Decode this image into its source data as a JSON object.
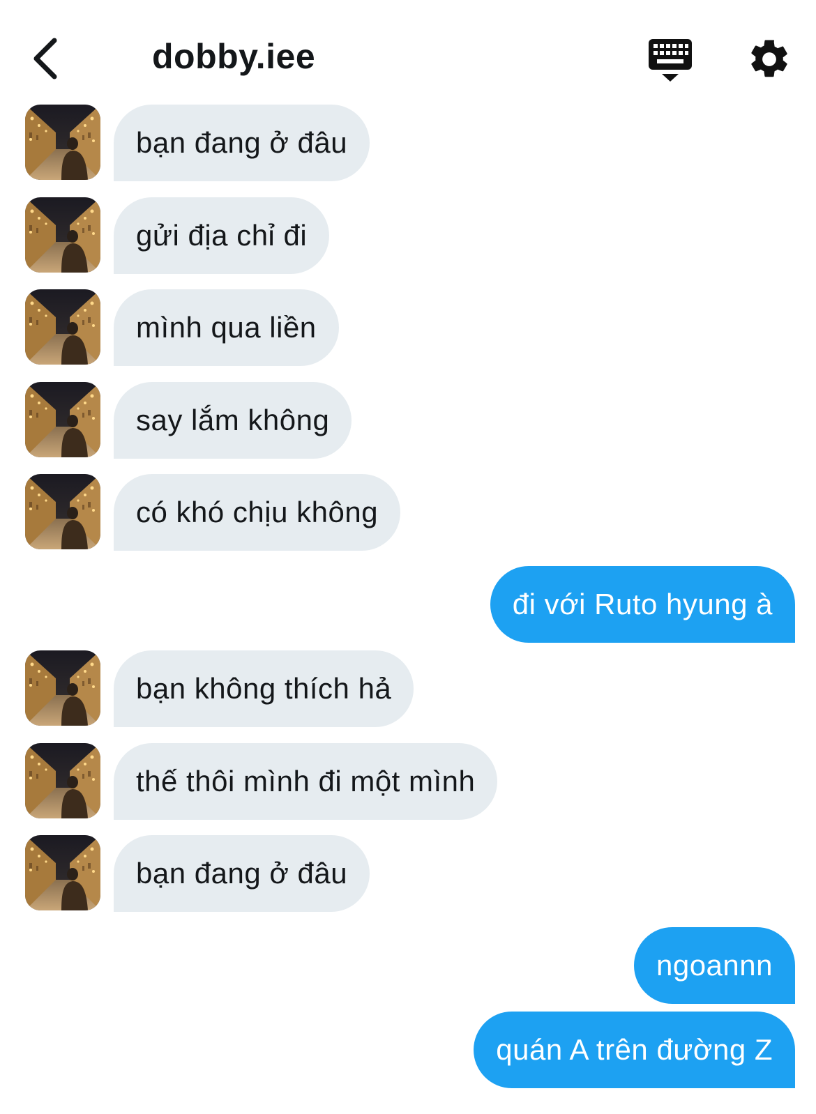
{
  "header": {
    "title": "dobby.iee",
    "icons": {
      "back": "chevron-left-icon",
      "keyboard": "keyboard-icon",
      "settings": "gear-icon"
    }
  },
  "colors": {
    "incoming_bubble": "#e6ecf0",
    "outgoing_bubble": "#1da1f2",
    "text": "#14171a"
  },
  "messages": [
    {
      "from": "them",
      "text": "bạn đang ở đâu"
    },
    {
      "from": "them",
      "text": "gửi địa chỉ đi"
    },
    {
      "from": "them",
      "text": "mình qua liền"
    },
    {
      "from": "them",
      "text": "say lắm không"
    },
    {
      "from": "them",
      "text": "có khó chịu không"
    },
    {
      "from": "me",
      "text": "đi với Ruto hyung à"
    },
    {
      "from": "them",
      "text": "bạn không thích hả"
    },
    {
      "from": "them",
      "text": "thế thôi mình đi một mình"
    },
    {
      "from": "them",
      "text": "bạn đang ở đâu"
    },
    {
      "from": "me",
      "text": "ngoannn"
    },
    {
      "from": "me",
      "text": "quán A trên đường Z"
    }
  ]
}
